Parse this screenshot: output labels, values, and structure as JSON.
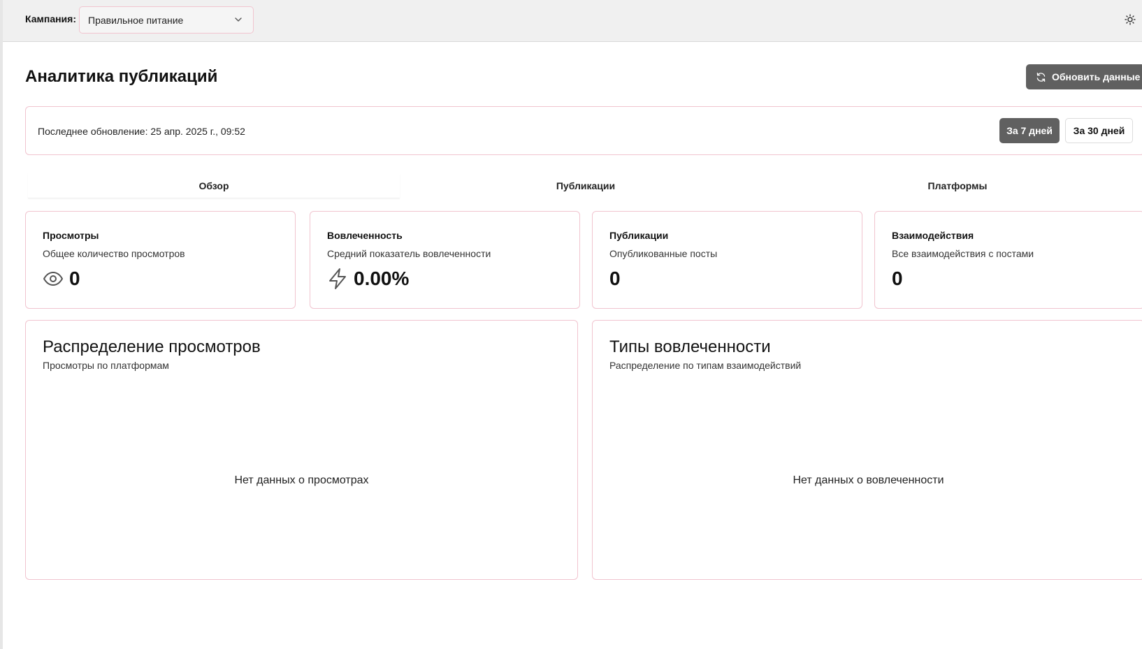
{
  "topbar": {
    "campaign_label": "Кампания:",
    "campaign_value": "Правильное питание",
    "theme_icon": "sun-icon"
  },
  "header": {
    "title": "Аналитика публикаций",
    "refresh_label": "Обновить данные"
  },
  "update": {
    "text": "Последнее обновление: 25 апр. 2025 г., 09:52",
    "periods": [
      {
        "label": "За 7 дней",
        "active": true
      },
      {
        "label": "За 30 дней",
        "active": false
      }
    ]
  },
  "tabs": [
    {
      "label": "Обзор",
      "active": true
    },
    {
      "label": "Публикации",
      "active": false
    },
    {
      "label": "Платформы",
      "active": false
    }
  ],
  "stats": [
    {
      "title": "Просмотры",
      "desc": "Общее количество просмотров",
      "value": "0",
      "icon": "eye-icon"
    },
    {
      "title": "Вовлеченность",
      "desc": "Средний показатель вовлеченности",
      "value": "0.00%",
      "icon": "lightning-icon"
    },
    {
      "title": "Публикации",
      "desc": "Опубликованные посты",
      "value": "0",
      "icon": ""
    },
    {
      "title": "Взаимодействия",
      "desc": "Все взаимодействия с постами",
      "value": "0",
      "icon": ""
    }
  ],
  "charts": [
    {
      "title": "Распределение просмотров",
      "subtitle": "Просмотры по платформам",
      "empty": "Нет данных о просмотрах"
    },
    {
      "title": "Типы вовлеченности",
      "subtitle": "Распределение по типам взаимодействий",
      "empty": "Нет данных о вовлеченности"
    }
  ],
  "colors": {
    "accent_dark": "#606060",
    "card_border": "#f1c4cf",
    "topbar_bg": "#f0f0f0"
  }
}
